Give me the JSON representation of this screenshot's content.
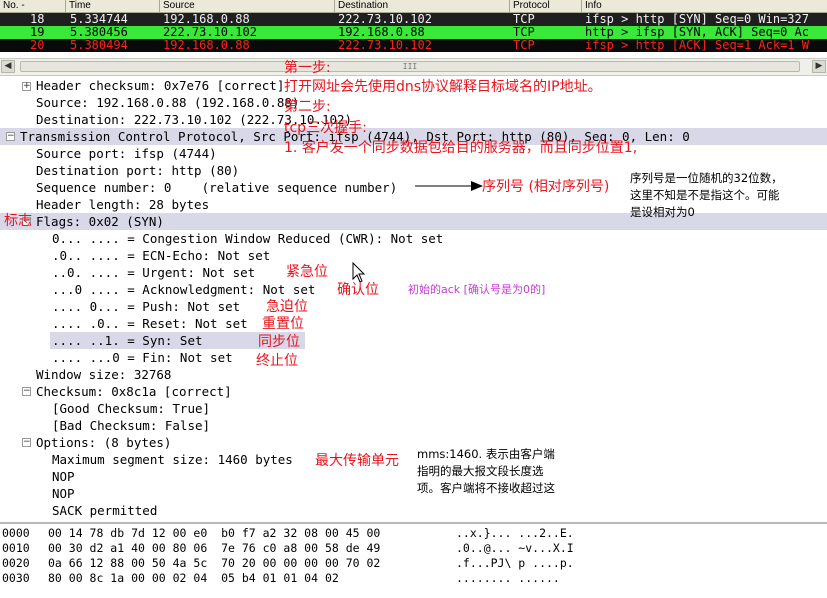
{
  "packet_list": {
    "columns": [
      "No. -",
      "Time",
      "Source",
      "Destination",
      "Protocol",
      "Info"
    ],
    "rows": [
      {
        "no": "18",
        "time": "5.334744",
        "source": "192.168.0.88",
        "destination": "222.73.10.102",
        "protocol": "TCP",
        "info": "ifsp > http [SYN] Seq=0 Win=327",
        "bg": "#1f1f1f",
        "fg": "#f0f0f0"
      },
      {
        "no": "19",
        "time": "5.380456",
        "source": "222.73.10.102",
        "destination": "192.168.0.88",
        "protocol": "TCP",
        "info": "http > ifsp [SYN, ACK] Seq=0 Ac",
        "bg": "#39e839",
        "fg": "#000000"
      },
      {
        "no": "20",
        "time": "5.380494",
        "source": "192.168.0.88",
        "destination": "222.73.10.102",
        "protocol": "TCP",
        "info": "ifsp > http [ACK] Seq=1 Ack=1 W",
        "bg": "#0a0a0a",
        "fg": "#ff2020"
      }
    ]
  },
  "scroll_thumb": "III",
  "detail": {
    "header_checksum": "Header checksum: 0x7e76 [correct]",
    "source": "Source: 192.168.0.88 (192.168.0.88)",
    "destination": "Destination: 222.73.10.102 (222.73.10.102)",
    "tcp_header": "Transmission Control Protocol, Src Port: ifsp (4744), Dst Port: http (80), Seq: 0, Len: 0",
    "src_port": "Source port: ifsp (4744)",
    "dst_port": "Destination port: http (80)",
    "seq": "Sequence number: 0    (relative sequence number)",
    "hdr_len": "Header length: 28 bytes",
    "flags": "Flags: 0x02 (SYN)",
    "cwr": "0... .... = Congestion Window Reduced (CWR): Not set",
    "ecn": ".0.. .... = ECN-Echo: Not set",
    "urg": "..0. .... = Urgent: Not set",
    "ack": "...0 .... = Acknowledgment: Not set",
    "psh": ".... 0... = Push: Not set",
    "rst": ".... .0.. = Reset: Not set",
    "syn": ".... ..1. = Syn: Set",
    "fin": ".... ...0 = Fin: Not set",
    "win": "Window size: 32768",
    "checksum": "Checksum: 0x8c1a [correct]",
    "good_cs": "[Good Checksum: True]",
    "bad_cs": "[Bad Checksum: False]",
    "options": "Options: (8 bytes)",
    "mss": "Maximum segment size: 1460 bytes",
    "nop1": "NOP",
    "nop2": "NOP",
    "sack": "SACK permitted"
  },
  "annotations": {
    "step1": "第一步:",
    "step1_text": "打开网址会先使用dns协议解释目标域名的IP地址。",
    "step2": "第二步:",
    "tcp_handshake": "tcp三次握手:",
    "handshake_1": "1. 客户发一个同步数据包给目的服务器，而且同步位置1,",
    "seq_label": "序列号 (相对序列号)",
    "seq_note": "序列号是一位随机的32位数，\n这里不知是不是指这个。可能\n是设相对为0",
    "flag_label": "标志",
    "urg_label": "紧急位",
    "ack_label": "确认位",
    "ack_note": "初始的ack [确认号是为0的]",
    "psh_label": "急迫位",
    "rst_label": "重置位",
    "syn_label": "同步位",
    "fin_label": "终止位",
    "mss_label": "最大传输单元",
    "mss_note": "mms:1460. 表示由客户端\n指明的最大报文段长度选\n项。客户端将不接收超过这"
  },
  "hex": [
    {
      "off": "0000",
      "bytes": "00 14 78 db 7d 12 00 e0  b0 f7 a2 32 08 00 45 00",
      "ascii": "..x.}... ...2..E."
    },
    {
      "off": "0010",
      "bytes": "00 30 d2 a1 40 00 80 06  7e 76 c0 a8 00 58 de 49",
      "ascii": ".0..@... ~v...X.I"
    },
    {
      "off": "0020",
      "bytes": "0a 66 12 88 00 50 4a 5c  70 20 00 00 00 00 70 02",
      "ascii": ".f...PJ\\ p ....p."
    },
    {
      "off": "0030",
      "bytes": "80 00 8c 1a 00 00 02 04  05 b4 01 01 04 02",
      "ascii": "........ ......"
    }
  ]
}
